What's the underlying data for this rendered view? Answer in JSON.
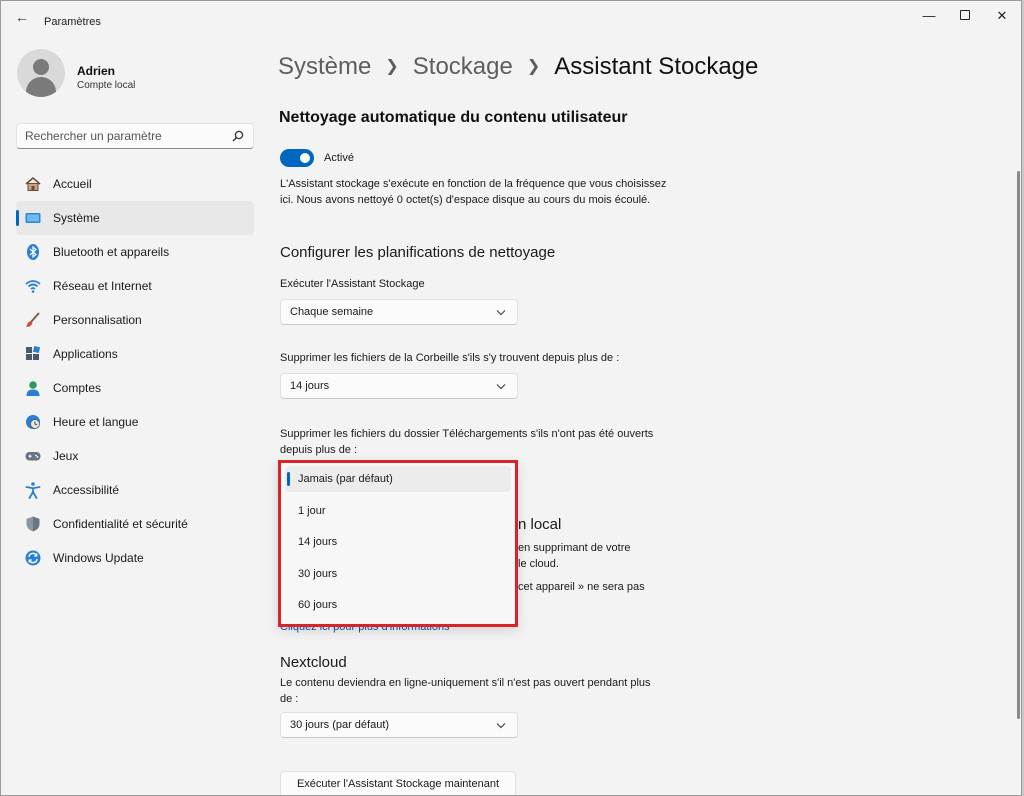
{
  "app": {
    "title": "Paramètres"
  },
  "user": {
    "name": "Adrien",
    "account": "Compte local"
  },
  "search": {
    "placeholder": "Rechercher un paramètre"
  },
  "sidebar": {
    "items": [
      {
        "label": "Accueil",
        "icon": "home-icon"
      },
      {
        "label": "Système",
        "icon": "system-icon",
        "active": true
      },
      {
        "label": "Bluetooth et appareils",
        "icon": "bluetooth-icon"
      },
      {
        "label": "Réseau et Internet",
        "icon": "wifi-icon"
      },
      {
        "label": "Personnalisation",
        "icon": "brush-icon"
      },
      {
        "label": "Applications",
        "icon": "apps-icon"
      },
      {
        "label": "Comptes",
        "icon": "account-icon"
      },
      {
        "label": "Heure et langue",
        "icon": "clock-globe-icon"
      },
      {
        "label": "Jeux",
        "icon": "gamepad-icon"
      },
      {
        "label": "Accessibilité",
        "icon": "accessibility-icon"
      },
      {
        "label": "Confidentialité et sécurité",
        "icon": "shield-icon"
      },
      {
        "label": "Windows Update",
        "icon": "update-icon"
      }
    ]
  },
  "breadcrumb": {
    "level1": "Système",
    "level2": "Stockage",
    "current": "Assistant Stockage"
  },
  "main": {
    "section_title": "Nettoyage automatique du contenu utilisateur",
    "toggle_label": "Activé",
    "description": "L'Assistant stockage s'exécute en fonction de la fréquence que vous choisissez ici. Nous avons nettoyé 0 octet(s) d'espace disque au cours du mois écoulé.",
    "schedule_heading": "Configurer les planifications de nettoyage",
    "run_label": "Exécuter l'Assistant Stockage",
    "run_value": "Chaque semaine",
    "recycle_label": "Supprimer les fichiers de la Corbeille s'ils s'y trouvent depuis plus de :",
    "recycle_value": "14 jours",
    "downloads_label": "Supprimer les fichiers du dossier Téléchargements s'ils n'ont pas été ouverts depuis plus de :",
    "hidden_heading_fragment": "n local",
    "hidden_line1_fragment": "en supprimant de votre",
    "hidden_line2_fragment": "le cloud.",
    "hidden_line3_fragment": "cet appareil » ne sera pas",
    "link_text": "Cliquez ici pour plus d'informations",
    "nextcloud_heading": "Nextcloud",
    "nextcloud_desc": "Le contenu deviendra en ligne-uniquement s'il n'est pas ouvert pendant plus de :",
    "nextcloud_value": "30 jours (par défaut)",
    "run_now_button": "Exécuter l'Assistant Stockage maintenant"
  },
  "popup": {
    "options": [
      "Jamais (par défaut)",
      "1 jour",
      "14 jours",
      "30 jours",
      "60 jours"
    ],
    "selected_index": 0
  },
  "colors": {
    "accent": "#0067c0",
    "highlight_border": "#d8232a"
  }
}
